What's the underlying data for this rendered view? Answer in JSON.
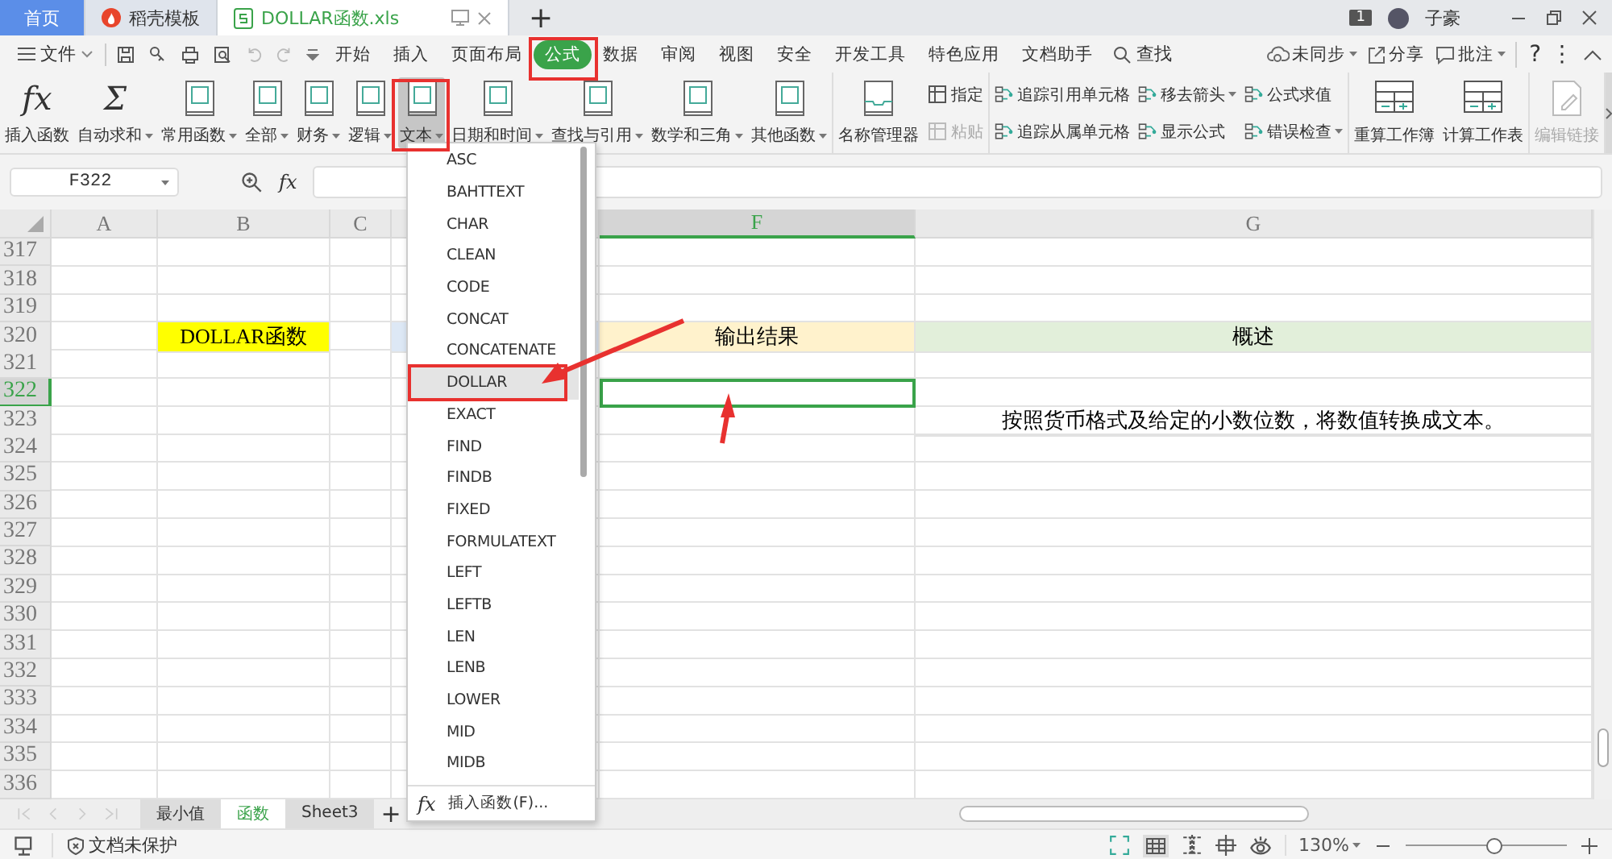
{
  "title_bar": {
    "tabs": [
      {
        "label": "首页",
        "selected": false,
        "kind": "home"
      },
      {
        "label": "稻壳模板",
        "selected": false,
        "kind": "docer"
      },
      {
        "label": "DOLLAR函数.xls",
        "selected": true,
        "kind": "workbook"
      }
    ],
    "new_tab": "+",
    "badge": "1",
    "user": "子豪"
  },
  "menu_bar": {
    "file": "文件",
    "tabs": [
      {
        "label": "开始",
        "selected": false
      },
      {
        "label": "插入",
        "selected": false
      },
      {
        "label": "页面布局",
        "selected": false
      },
      {
        "label": "公式",
        "selected": true
      },
      {
        "label": "数据",
        "selected": false
      },
      {
        "label": "审阅",
        "selected": false
      },
      {
        "label": "视图",
        "selected": false
      },
      {
        "label": "安全",
        "selected": false
      },
      {
        "label": "开发工具",
        "selected": false
      },
      {
        "label": "特色应用",
        "selected": false
      },
      {
        "label": "文档助手",
        "selected": false
      }
    ],
    "search": "查找",
    "actions": [
      {
        "label": "未同步",
        "kind": "sync",
        "dropdown": true
      },
      {
        "label": "分享",
        "kind": "share",
        "dropdown": false
      },
      {
        "label": "批注",
        "kind": "comment",
        "dropdown": true
      }
    ],
    "help": "?",
    "more": "⋮"
  },
  "ribbon": {
    "groups": [
      {
        "kind": "functions",
        "items": [
          {
            "kind": "large",
            "glyph": "fx",
            "label": "插入函数",
            "dropdown": false,
            "selected": false,
            "disabled": false
          },
          {
            "kind": "large",
            "glyph": "Σ",
            "label": "自动求和",
            "dropdown": true,
            "selected": false,
            "disabled": false
          },
          {
            "kind": "large",
            "label": "常用函数",
            "dropdown": true,
            "selected": false,
            "disabled": false
          },
          {
            "kind": "large",
            "label": "全部",
            "dropdown": true,
            "selected": false,
            "disabled": false
          },
          {
            "kind": "large",
            "label": "财务",
            "dropdown": true,
            "selected": false,
            "disabled": false
          },
          {
            "kind": "large",
            "label": "逻辑",
            "dropdown": true,
            "selected": false,
            "disabled": false
          },
          {
            "kind": "large",
            "label": "文本",
            "dropdown": true,
            "selected": true,
            "disabled": false
          },
          {
            "kind": "large",
            "label": "日期和时间",
            "dropdown": true,
            "selected": false,
            "disabled": false
          },
          {
            "kind": "large",
            "label": "查找与引用",
            "dropdown": true,
            "selected": false,
            "disabled": false
          },
          {
            "kind": "large",
            "label": "数学和三角",
            "dropdown": true,
            "selected": false,
            "disabled": false
          },
          {
            "kind": "large",
            "label": "其他函数",
            "dropdown": true,
            "selected": false,
            "disabled": false
          }
        ]
      },
      {
        "kind": "names",
        "items": [
          {
            "kind": "large",
            "label": "名称管理器",
            "dropdown": false,
            "selected": false,
            "disabled": false
          },
          {
            "kind": "small",
            "label": "指定",
            "dropdown": false,
            "selected": false,
            "disabled": false
          },
          {
            "kind": "small",
            "label": "粘贴",
            "dropdown": false,
            "selected": false,
            "disabled": true
          }
        ]
      },
      {
        "kind": "auditing",
        "items": [
          {
            "kind": "small",
            "label": "追踪引用单元格",
            "dropdown": false,
            "selected": false,
            "disabled": false
          },
          {
            "kind": "small",
            "label": "追踪从属单元格",
            "dropdown": false,
            "selected": false,
            "disabled": false
          },
          {
            "kind": "small",
            "label": "移去箭头",
            "dropdown": true,
            "selected": false,
            "disabled": false
          },
          {
            "kind": "small",
            "label": "显示公式",
            "dropdown": false,
            "selected": false,
            "disabled": false
          },
          {
            "kind": "small",
            "label": "公式求值",
            "dropdown": false,
            "selected": false,
            "disabled": false
          },
          {
            "kind": "small",
            "label": "错误检查",
            "dropdown": true,
            "selected": false,
            "disabled": false
          }
        ]
      },
      {
        "kind": "calculation",
        "items": [
          {
            "kind": "large",
            "label": "重算工作簿",
            "dropdown": false,
            "selected": false,
            "disabled": false
          },
          {
            "kind": "large",
            "label": "计算工作表",
            "dropdown": false,
            "selected": false,
            "disabled": false
          }
        ]
      },
      {
        "kind": "links",
        "items": [
          {
            "kind": "large",
            "label": "编辑链接",
            "dropdown": false,
            "selected": false,
            "disabled": true
          }
        ]
      }
    ]
  },
  "formula_bar": {
    "cell": "F322",
    "fx": "fx"
  },
  "sheet": {
    "columns": [
      {
        "label": "A",
        "selected": false
      },
      {
        "label": "B",
        "selected": false
      },
      {
        "label": "C",
        "selected": false
      },
      {
        "selected": false
      },
      {
        "label": "F",
        "selected": true
      },
      {
        "label": "G",
        "selected": false
      }
    ],
    "rows": [
      {
        "label": "317",
        "selected": false
      },
      {
        "label": "318",
        "selected": false
      },
      {
        "label": "319",
        "selected": false
      },
      {
        "label": "320",
        "selected": false,
        "cells": {
          "col_2": {
            "text": "DOLLAR函数",
            "color": "#ffff00"
          },
          "col_4": {
            "color": "#dde8f5"
          },
          "col_5": {
            "text": "输出结果",
            "color": "#fff2cc"
          },
          "col_6": {
            "text": "概述",
            "color": "#e2efda"
          }
        }
      },
      {
        "label": "321",
        "selected": false
      },
      {
        "label": "322",
        "selected": true
      },
      {
        "label": "323",
        "selected": false,
        "cells": {
          "col_6": {
            "text": "按照货币格式及给定的小数位数，将数值转换成文本。"
          }
        }
      },
      {
        "label": "324",
        "selected": false
      },
      {
        "label": "325",
        "selected": false
      },
      {
        "label": "326",
        "selected": false
      },
      {
        "label": "327",
        "selected": false
      },
      {
        "label": "328",
        "selected": false
      },
      {
        "label": "329",
        "selected": false
      },
      {
        "label": "330",
        "selected": false
      },
      {
        "label": "331",
        "selected": false
      },
      {
        "label": "332",
        "selected": false
      },
      {
        "label": "333",
        "selected": false
      },
      {
        "label": "334",
        "selected": false
      },
      {
        "label": "335",
        "selected": false
      },
      {
        "label": "336",
        "selected": false
      }
    ]
  },
  "function_menu": {
    "items": [
      {
        "label": "ASC",
        "selected": false
      },
      {
        "label": "BAHTTEXT",
        "selected": false
      },
      {
        "label": "CHAR",
        "selected": false
      },
      {
        "label": "CLEAN",
        "selected": false
      },
      {
        "label": "CODE",
        "selected": false
      },
      {
        "label": "CONCAT",
        "selected": false
      },
      {
        "label": "CONCATENATE",
        "selected": false
      },
      {
        "label": "DOLLAR",
        "selected": true
      },
      {
        "label": "EXACT",
        "selected": false
      },
      {
        "label": "FIND",
        "selected": false
      },
      {
        "label": "FINDB",
        "selected": false
      },
      {
        "label": "FIXED",
        "selected": false
      },
      {
        "label": "FORMULATEXT",
        "selected": false
      },
      {
        "label": "LEFT",
        "selected": false
      },
      {
        "label": "LEFTB",
        "selected": false
      },
      {
        "label": "LEN",
        "selected": false
      },
      {
        "label": "LENB",
        "selected": false
      },
      {
        "label": "LOWER",
        "selected": false
      },
      {
        "label": "MID",
        "selected": false
      },
      {
        "label": "MIDB",
        "selected": false
      }
    ],
    "footer": {
      "glyph": "fx",
      "label": "插入函数(F)..."
    }
  },
  "sheet_tabs": {
    "tabs": [
      {
        "label": "最小值",
        "selected": false
      },
      {
        "label": "函数",
        "selected": true
      },
      {
        "label": "Sheet3",
        "selected": false
      }
    ],
    "add": "+"
  },
  "status_bar": {
    "protection": "文档未保护",
    "zoom": "130%",
    "zoom_slider": {
      "level": 0.55
    }
  }
}
